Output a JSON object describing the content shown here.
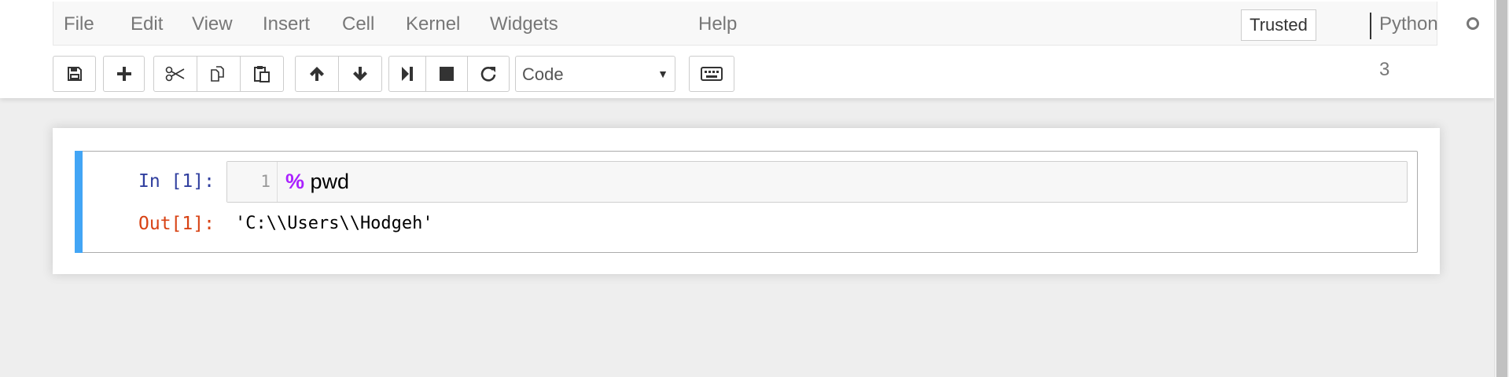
{
  "menubar": {
    "items": [
      {
        "label": "File"
      },
      {
        "label": "Edit"
      },
      {
        "label": "View"
      },
      {
        "label": "Insert"
      },
      {
        "label": "Cell"
      },
      {
        "label": "Kernel"
      },
      {
        "label": "Widgets"
      },
      {
        "label": "Help"
      }
    ],
    "trusted_label": "Trusted",
    "kernel_name": "Python 3",
    "kernel_status": "idle"
  },
  "toolbar": {
    "buttons": [
      {
        "icon": "save-icon"
      },
      {
        "icon": "plus-icon"
      },
      {
        "icon": "cut-icon"
      },
      {
        "icon": "copy-icon"
      },
      {
        "icon": "paste-icon"
      },
      {
        "icon": "arrow-up-icon"
      },
      {
        "icon": "arrow-down-icon"
      },
      {
        "icon": "step-forward-icon"
      },
      {
        "icon": "stop-icon"
      },
      {
        "icon": "refresh-icon"
      },
      {
        "icon": "keyboard-icon"
      }
    ],
    "cell_type": "Code"
  },
  "cell": {
    "input_prompt": "In [1]:",
    "line_number": "1",
    "code_magic": "%",
    "code_rest": " pwd",
    "output_prompt": "Out[1]:",
    "output_text": "'C:\\\\Users\\\\Hodgeh'"
  },
  "colors": {
    "accent_bar": "#42a5f5",
    "in_prompt": "#303f9f",
    "out_prompt": "#d84315",
    "magic": "#aa22ff"
  }
}
